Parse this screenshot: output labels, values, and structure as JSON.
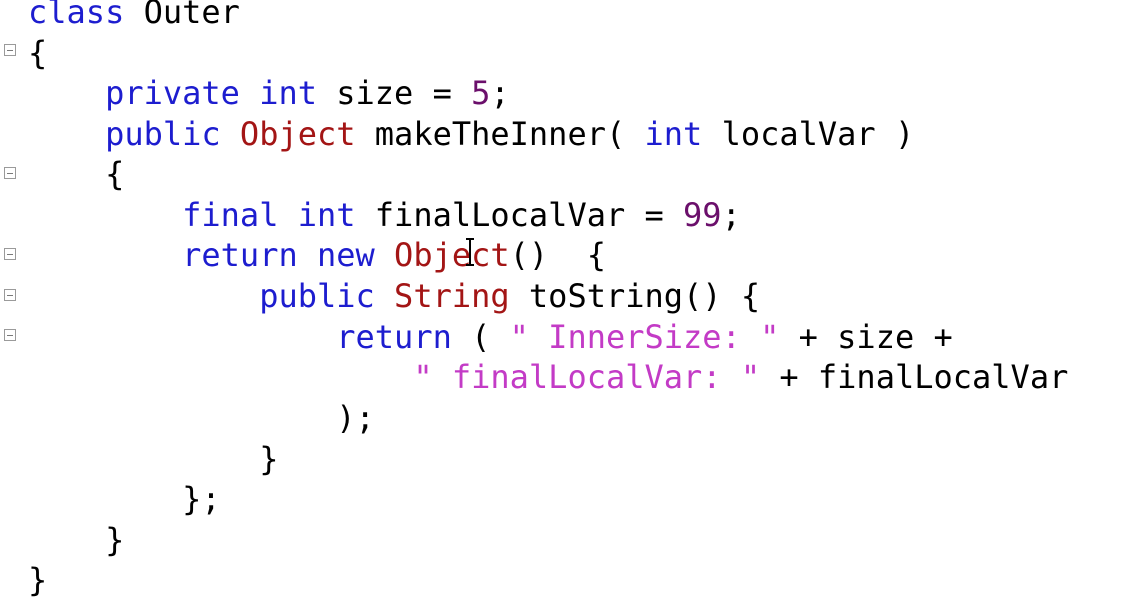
{
  "editor": {
    "colors": {
      "keyword": "#1d1dcf",
      "type": "#a31515",
      "string": "#c33bc6",
      "number": "#6b0f6b",
      "plain": "#000000"
    },
    "lines": [
      [
        {
          "t": "class",
          "c": "kw"
        },
        {
          "t": " Outer",
          "c": "pl"
        }
      ],
      [
        {
          "t": "{",
          "c": "pl"
        }
      ],
      [
        {
          "t": "    ",
          "c": "pl"
        },
        {
          "t": "private",
          "c": "kw"
        },
        {
          "t": " ",
          "c": "pl"
        },
        {
          "t": "int",
          "c": "kw"
        },
        {
          "t": " size = ",
          "c": "pl"
        },
        {
          "t": "5",
          "c": "nu"
        },
        {
          "t": ";",
          "c": "pl"
        }
      ],
      [
        {
          "t": "    ",
          "c": "pl"
        },
        {
          "t": "public",
          "c": "kw"
        },
        {
          "t": " ",
          "c": "pl"
        },
        {
          "t": "Object",
          "c": "ty"
        },
        {
          "t": " makeTheInner( ",
          "c": "pl"
        },
        {
          "t": "int",
          "c": "kw"
        },
        {
          "t": " localVar )",
          "c": "pl"
        }
      ],
      [
        {
          "t": "    {",
          "c": "pl"
        }
      ],
      [
        {
          "t": "        ",
          "c": "pl"
        },
        {
          "t": "final",
          "c": "kw"
        },
        {
          "t": " ",
          "c": "pl"
        },
        {
          "t": "int",
          "c": "kw"
        },
        {
          "t": " finalLocalVar = ",
          "c": "pl"
        },
        {
          "t": "99",
          "c": "nu"
        },
        {
          "t": ";",
          "c": "pl"
        }
      ],
      [
        {
          "t": "        ",
          "c": "pl"
        },
        {
          "t": "return",
          "c": "kw"
        },
        {
          "t": " ",
          "c": "pl"
        },
        {
          "t": "new",
          "c": "kw"
        },
        {
          "t": " ",
          "c": "pl"
        },
        {
          "t": "Object",
          "c": "ty"
        },
        {
          "t": "()  {",
          "c": "pl"
        }
      ],
      [
        {
          "t": "            ",
          "c": "pl"
        },
        {
          "t": "public",
          "c": "kw"
        },
        {
          "t": " ",
          "c": "pl"
        },
        {
          "t": "String",
          "c": "ty"
        },
        {
          "t": " toString() {",
          "c": "pl"
        }
      ],
      [
        {
          "t": "                ",
          "c": "pl"
        },
        {
          "t": "return",
          "c": "kw"
        },
        {
          "t": " ( ",
          "c": "pl"
        },
        {
          "t": "\" InnerSize: \"",
          "c": "st"
        },
        {
          "t": " + size +",
          "c": "pl"
        }
      ],
      [
        {
          "t": "                    ",
          "c": "pl"
        },
        {
          "t": "\" finalLocalVar: \"",
          "c": "st"
        },
        {
          "t": " + finalLocalVar",
          "c": "pl"
        }
      ],
      [
        {
          "t": "                );",
          "c": "pl"
        }
      ],
      [
        {
          "t": "            }",
          "c": "pl"
        }
      ],
      [
        {
          "t": "        };",
          "c": "pl"
        }
      ],
      [
        {
          "t": "    }",
          "c": "pl"
        }
      ],
      [
        {
          "t": "}",
          "c": "pl"
        }
      ]
    ],
    "fold_markers": [
      "collapse-icon",
      "collapse-icon",
      "collapse-icon",
      "collapse-icon",
      "collapse-icon"
    ]
  }
}
